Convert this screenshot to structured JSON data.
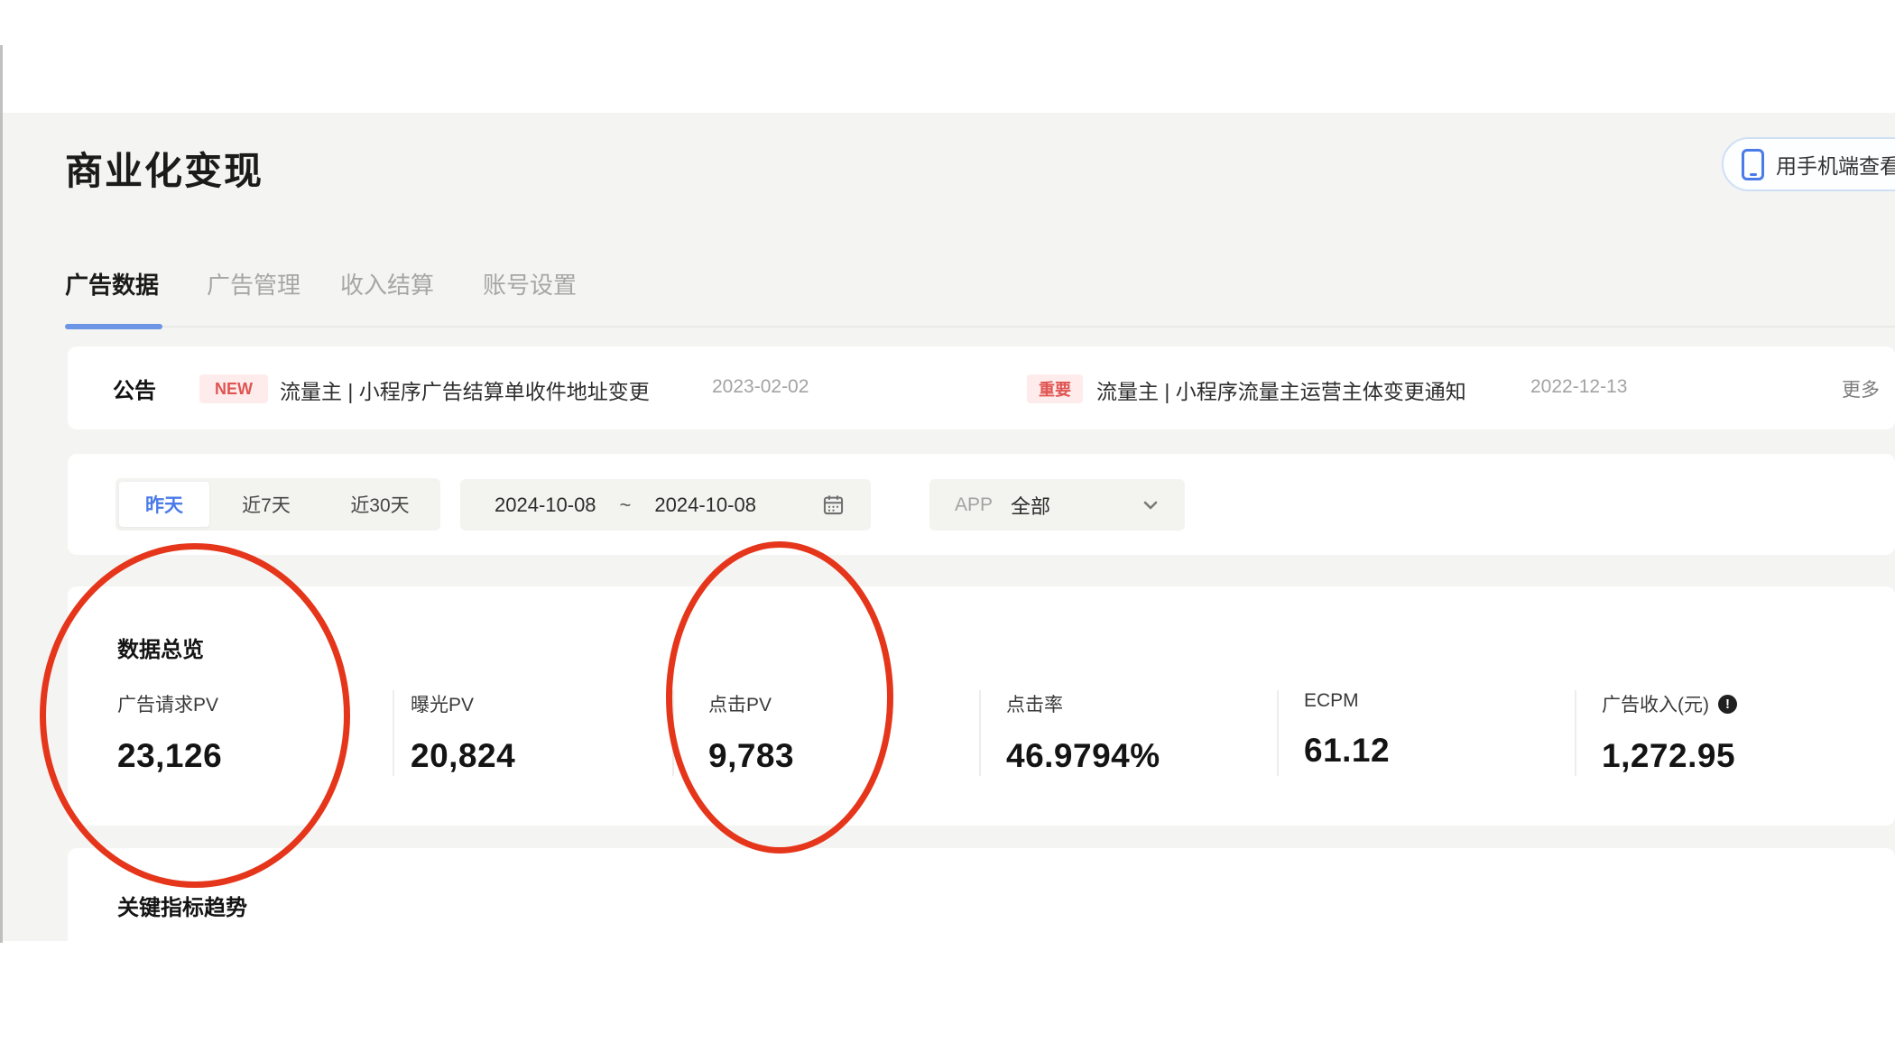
{
  "page": {
    "title": "商业化变现"
  },
  "header": {
    "mobile_button": "用手机端查看数据"
  },
  "tabs": {
    "items": [
      {
        "label": "广告数据",
        "active": true
      },
      {
        "label": "广告管理",
        "active": false
      },
      {
        "label": "收入结算",
        "active": false
      },
      {
        "label": "账号设置",
        "active": false
      }
    ]
  },
  "announcement": {
    "label": "公告",
    "items": [
      {
        "badge": "NEW",
        "text": "流量主 | 小程序广告结算单收件地址变更",
        "date": "2023-02-02"
      },
      {
        "badge": "重要",
        "text": "流量主 | 小程序流量主运营主体变更通知",
        "date": "2022-12-13"
      }
    ],
    "more": "更多"
  },
  "filters": {
    "presets": [
      {
        "label": "昨天",
        "active": true
      },
      {
        "label": "近7天",
        "active": false
      },
      {
        "label": "近30天",
        "active": false
      }
    ],
    "date_start": "2024-10-08",
    "date_separator": "~",
    "date_end": "2024-10-08",
    "app_label": "APP",
    "app_value": "全部"
  },
  "overview": {
    "title": "数据总览",
    "metrics": [
      {
        "label": "广告请求PV",
        "value": "23,126",
        "circled": true
      },
      {
        "label": "曝光PV",
        "value": "20,824",
        "circled": false
      },
      {
        "label": "点击PV",
        "value": "9,783",
        "circled": true
      },
      {
        "label": "点击率",
        "value": "46.9794%",
        "circled": false
      },
      {
        "label": "ECPM",
        "value": "61.12",
        "circled": false
      },
      {
        "label": "广告收入(元)",
        "value": "1,272.95",
        "circled": false,
        "info_icon": "!"
      }
    ]
  },
  "trend": {
    "title": "关键指标趋势"
  },
  "icons": {
    "mobile": "phone-icon",
    "calendar": "calendar-icon",
    "chevron": "chevron-down-icon",
    "info": "info-icon"
  },
  "colors": {
    "accent_blue": "#4a7be8",
    "underline_blue": "#6c95e6",
    "badge_text_red": "#e05452",
    "badge_bg_pink": "#fdeceb",
    "annotation_red": "#e5361b",
    "page_bg": "#f4f4f2"
  }
}
